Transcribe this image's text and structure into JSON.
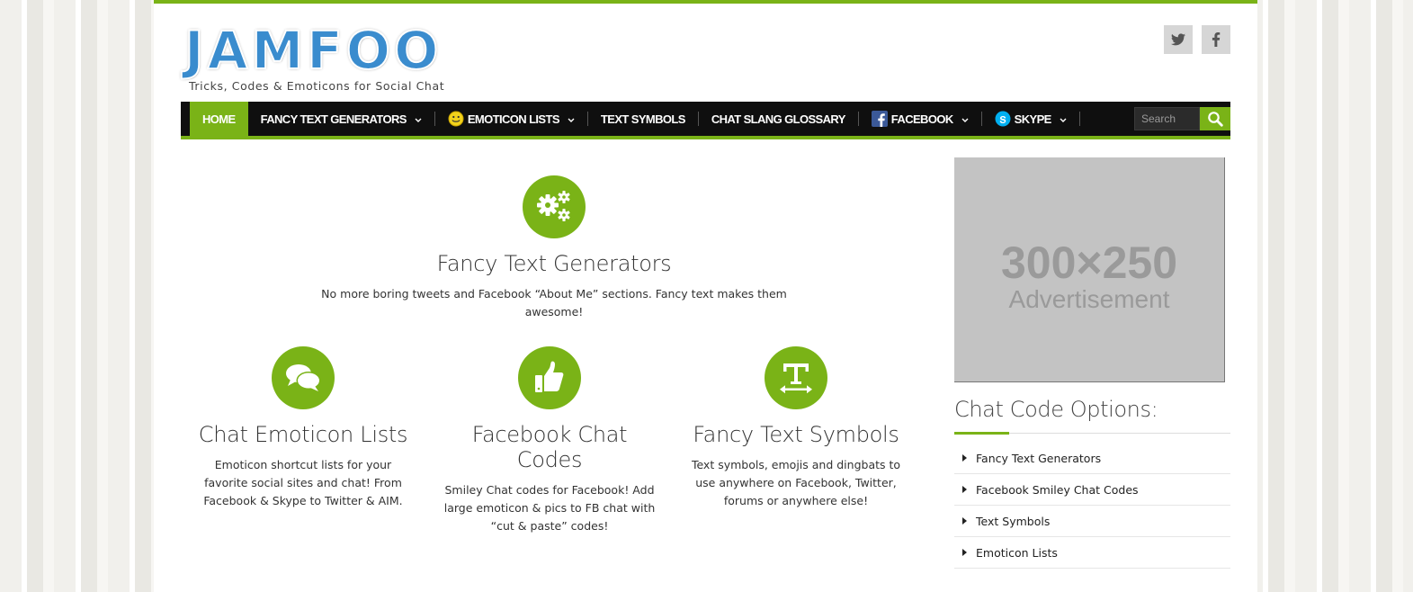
{
  "header": {
    "logo_text": "JAMFOO",
    "tagline": "Tricks, Codes & Emoticons for Social Chat",
    "social": [
      {
        "icon": "twitter-icon",
        "label": "Twitter"
      },
      {
        "icon": "facebook-icon",
        "label": "Facebook"
      }
    ]
  },
  "nav": {
    "home": "HOME",
    "fancy_text_generators": "FANCY TEXT GENERATORS",
    "emoticon_lists": "EMOTICON LISTS",
    "text_symbols": "TEXT SYMBOLS",
    "chat_slang_glossary": "CHAT SLANG GLOSSARY",
    "facebook": "FACEBOOK",
    "skype": "SKYPE",
    "search_placeholder": "Search"
  },
  "main": {
    "top_feature": {
      "icon": "gears-icon",
      "title": "Fancy Text Generators",
      "desc": "No more boring tweets and Facebook “About Me” sections. Fancy text makes them awesome!"
    },
    "features": [
      {
        "icon": "chat-bubbles-icon",
        "title": "Chat Emoticon Lists",
        "desc": "Emoticon shortcut lists for your favorite social sites and chat! From Facebook & Skype to Twitter & AIM."
      },
      {
        "icon": "thumbs-up-icon",
        "title": "Facebook Chat Codes",
        "desc": "Smiley Chat codes for Facebook! Add large emoticon & pics to FB chat with “cut & paste” codes!"
      },
      {
        "icon": "text-height-icon",
        "title": "Fancy Text Symbols",
        "desc": "Text symbols, emojis and dingbats to use anywhere on Facebook, Twitter, forums or anywhere else!"
      }
    ]
  },
  "sidebar": {
    "ad_size": "300×250",
    "ad_label": "Advertisement",
    "heading": "Chat Code Options:",
    "links": [
      "Fancy Text Generators",
      "Facebook Smiley Chat Codes",
      "Text Symbols",
      "Emoticon Lists"
    ]
  },
  "colors": {
    "accent": "#7ab317",
    "logo_blue": "#3a8cce",
    "nav_bg": "#0f0f0f"
  }
}
